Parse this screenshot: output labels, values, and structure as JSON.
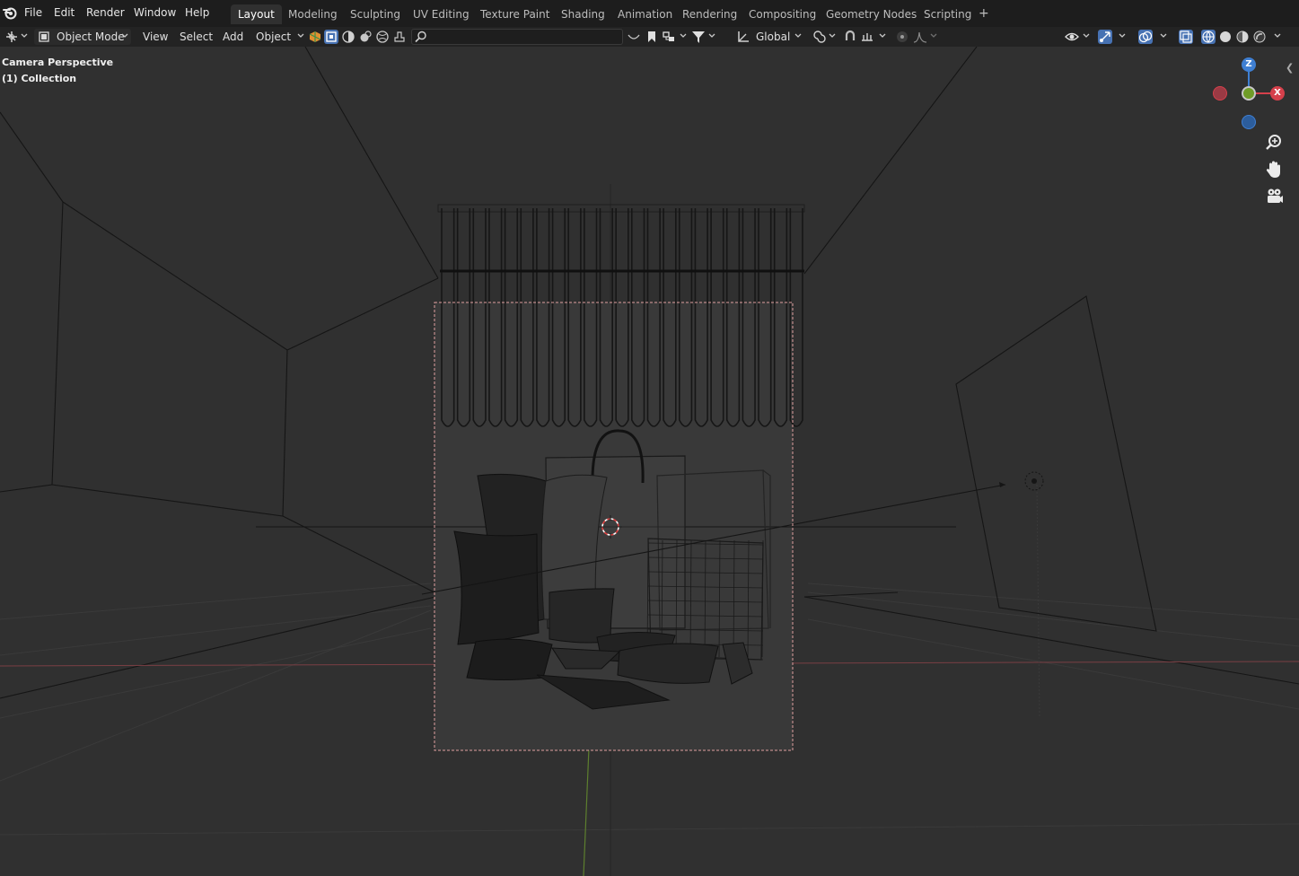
{
  "menu": {
    "items": [
      "File",
      "Edit",
      "Render",
      "Window",
      "Help"
    ]
  },
  "workspaces": {
    "tabs": [
      "Layout",
      "Modeling",
      "Sculpting",
      "UV Editing",
      "Texture Paint",
      "Shading",
      "Animation",
      "Rendering",
      "Compositing",
      "Geometry Nodes",
      "Scripting"
    ],
    "active": "Layout",
    "add_label": "+"
  },
  "header": {
    "mode": "Object Mode",
    "menus": [
      "View",
      "Select",
      "Add",
      "Object"
    ],
    "search_placeholder": "",
    "transform_orientation": "Global"
  },
  "viewport": {
    "camera_label": "Camera Perspective",
    "collection_label": "(1) Collection"
  },
  "gizmo": {
    "z_label": "Z",
    "x_label": "X",
    "colors": {
      "x": "#d5404b",
      "y": "#6f9c27",
      "z": "#3f7fd2"
    }
  },
  "icons": {
    "editor_type": "viewport-editor-icon",
    "zoom": "zoom-icon",
    "pan": "hand-icon",
    "camera": "camera-view-icon"
  }
}
